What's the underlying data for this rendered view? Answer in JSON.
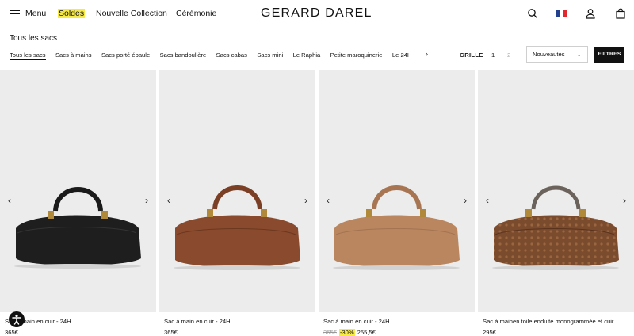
{
  "header": {
    "menu_label": "Menu",
    "nav": [
      "Soldes",
      "Nouvelle Collection",
      "Cérémonie"
    ],
    "logo": "GERARD DAREL",
    "icons": [
      "search-icon",
      "flag-icon",
      "account-icon",
      "bag-icon"
    ]
  },
  "page": {
    "title": "Tous les sacs",
    "categories": [
      "Tous les sacs",
      "Sacs à mains",
      "Sacs porté épaule",
      "Sacs bandoulière",
      "Sacs cabas",
      "Sacs mini",
      "Le Raphia",
      "Petite maroquinerie",
      "Le 24H"
    ],
    "active_category": "Tous les sacs",
    "view_label": "GRILLE",
    "grid_options": [
      "1",
      "2"
    ],
    "sort_value": "Nouveautés",
    "filters_label": "FILTRES"
  },
  "products": [
    {
      "name": "Sac à main en cuir - 24H",
      "price": "365€",
      "color": "#1e1e1e"
    },
    {
      "name": "Sac à main en cuir - 24H",
      "price": "365€",
      "color": "#8a4a2e"
    },
    {
      "name": "Sac à main en cuir - 24H",
      "old_price": "365€",
      "discount": "-30%",
      "price": "255,5€",
      "color": "#b98660"
    },
    {
      "name": "Sac à mainen toile enduite monogrammée et cuir ...",
      "price": "295€",
      "color": "#7b4b2e"
    }
  ],
  "colors": {
    "accent_yellow": "#f6e94a",
    "text": "#111111",
    "image_bg": "#ececec"
  }
}
